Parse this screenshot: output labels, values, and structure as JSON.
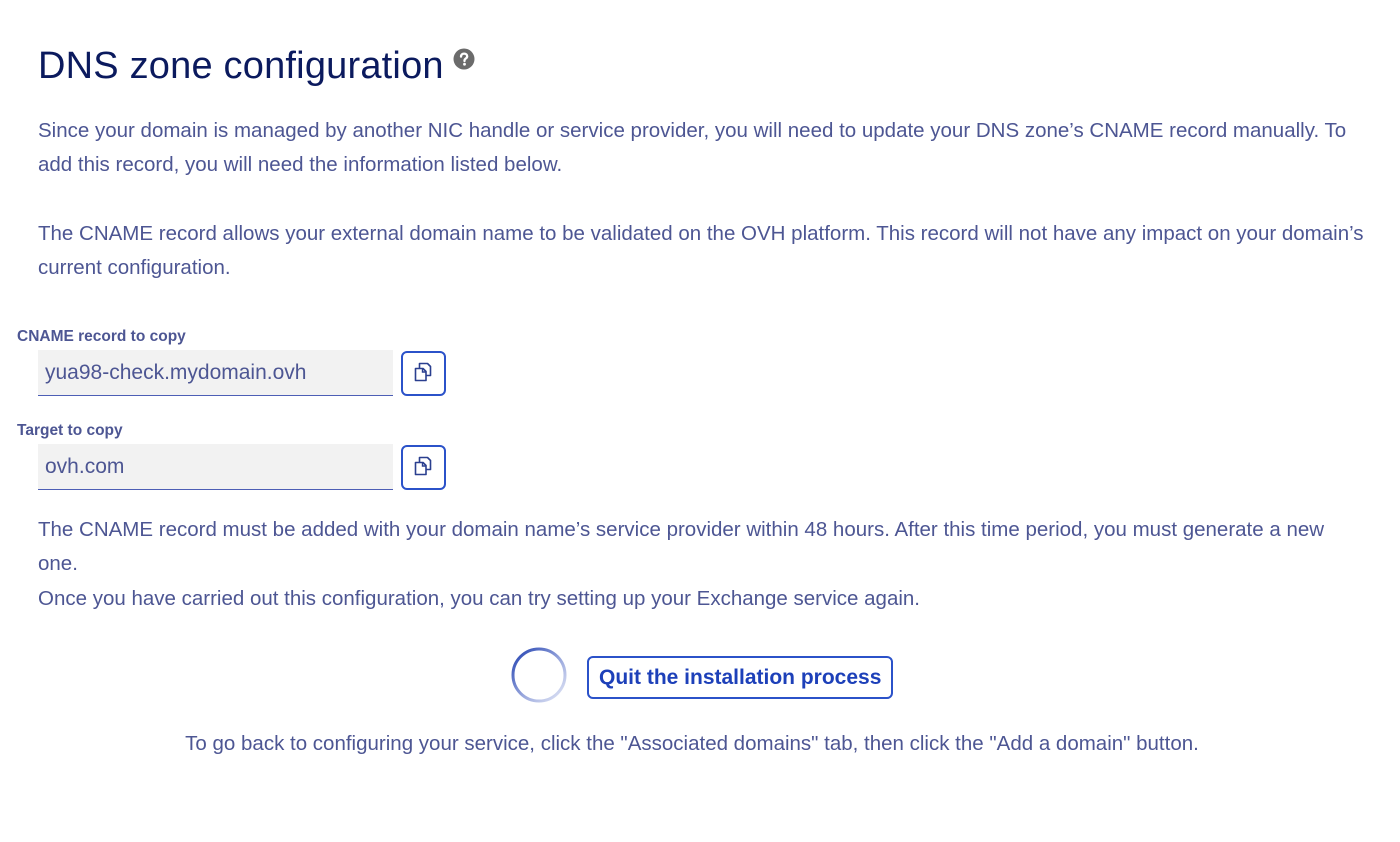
{
  "header": {
    "title": "DNS zone configuration",
    "help_icon": "question-circle-icon"
  },
  "intro": {
    "paragraph_1": "Since your domain is managed by another NIC handle or service provider, you will need to update your DNS zone’s CNAME record manually. To add this record, you will need the information listed below.",
    "paragraph_2": "The CNAME record allows your external domain name to be validated on the OVH platform. This record will not have any impact on your domain’s current configuration."
  },
  "fields": {
    "cname": {
      "label": "CNAME record to copy",
      "value": "yua98-check.mydomain.ovh",
      "copy_icon": "copy-icon"
    },
    "target": {
      "label": "Target to copy",
      "value": "ovh.com",
      "copy_icon": "copy-icon"
    }
  },
  "notes": {
    "deadline": "The CNAME record must be added with your domain name’s service provider within 48 hours. After this time period, you must generate a new one.",
    "retry": "Once you have carried out this configuration, you can try setting up your Exchange service again."
  },
  "actions": {
    "quit_label": "Quit the installation process",
    "spinner_icon": "loading-spinner-icon"
  },
  "footer": {
    "instruction": "To go back to configuring your service, click the \"Associated domains\" tab, then click the \"Add a domain\" button."
  },
  "colors": {
    "title": "#0b1a5e",
    "text": "#4d5693",
    "accent": "#2b52c9",
    "input_bg": "#f2f2f2"
  }
}
